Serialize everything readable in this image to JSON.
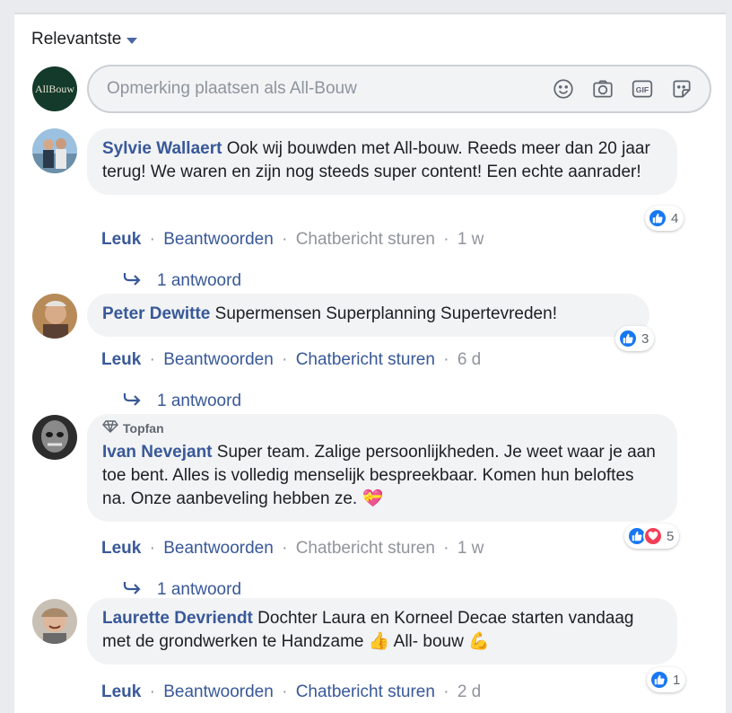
{
  "sort": {
    "label": "Relevantste"
  },
  "composer": {
    "logo_text": "AllBouw",
    "placeholder": "Opmerking plaatsen als All-Bouw"
  },
  "actions": {
    "like": "Leuk",
    "reply": "Beantwoorden",
    "message": "Chatbericht sturen",
    "separator": "·"
  },
  "comments": [
    {
      "author": "Sylvie Wallaert",
      "text": "Ook wij bouwden met All-bouw. Reeds meer dan 20 jaar terug! We waren en zijn nog steeds super content! Een echte aanrader!",
      "reaction_count": "4",
      "time": "1 w",
      "replies_label": "1 antwoord"
    },
    {
      "author": "Peter Dewitte",
      "text": "Supermensen Superplanning Supertevreden!",
      "reaction_count": "3",
      "time": "6 d",
      "replies_label": "1 antwoord"
    },
    {
      "badge": "Topfan",
      "author": "Ivan Nevejant",
      "text": "Super team. Zalige persoonlijkheden. Je weet waar je aan toe bent. Alles is volledig menselijk bespreekbaar. Komen hun beloftes na. Onze aanbeveling hebben ze. 💝",
      "reaction_count": "5",
      "time": "1 w",
      "replies_label": "1 antwoord"
    },
    {
      "author": "Laurette Devriendt",
      "text": "Dochter Laura en Korneel Decae starten vandaag met de grondwerken te Handzame 👍 All- bouw 💪",
      "reaction_count": "1",
      "time": "2 d"
    }
  ],
  "colors": {
    "link": "#385898",
    "like_blue": "#1877f2",
    "love_red": "#f33e58",
    "bubble": "#f2f3f5"
  },
  "icons": [
    "caret-down-icon",
    "emoji-icon",
    "camera-icon",
    "gif-icon",
    "sticker-icon",
    "reply-arrow-icon",
    "like-icon",
    "love-icon",
    "diamond-icon"
  ]
}
